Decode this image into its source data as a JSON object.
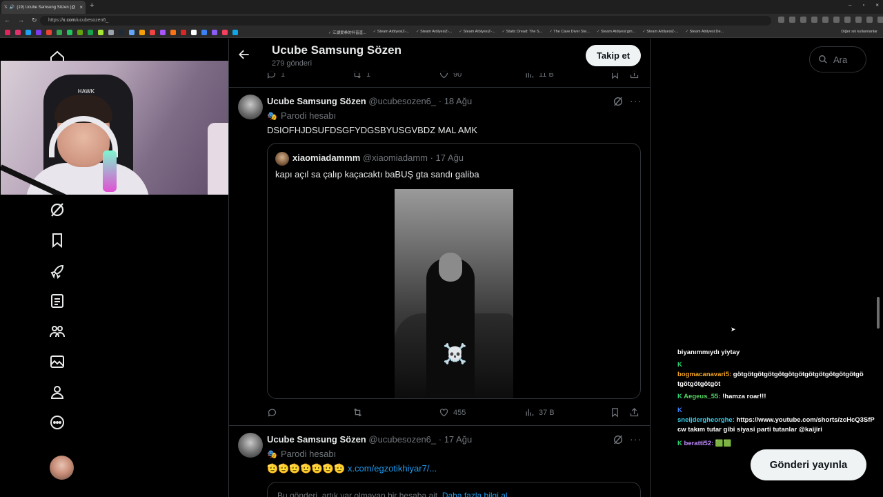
{
  "browser": {
    "tab_title": "(19) Ucube Samsung Sözen (@",
    "url_prefix": "https://",
    "url_host": "x.com",
    "url_path": "/ucubesozen6_",
    "bookmarks": [
      "江湖爱拳的抖音直...",
      "Steam AtölyesiZ-...",
      "Steam AtölyesiZ-...",
      "Steam AtölyesiZ-...",
      "Static Dread: The S...",
      "The Cave Diver Ste...",
      "Steam Atölyesi:gm...",
      "Steam AtölyesiZ-...",
      "Steam Atölyesi:De..."
    ],
    "bookmarks_other": "Diğer sık kullanılanlar",
    "bookmark_icon_colors": [
      "#e0245e",
      "#e1306c",
      "#1da1f2",
      "#7c3aed",
      "#ea4335",
      "#34a853",
      "#22c55e",
      "#65a30d",
      "#16a34a",
      "#a3e635",
      "#9ca3af",
      "#1f2937",
      "#60a5fa",
      "#f59e0b",
      "#ef4444",
      "#a855f7",
      "#f97316",
      "#dc2626",
      "#ffffff",
      "#3b82f6",
      "#8b5cf6",
      "#f43f5e",
      "#0ea5e9"
    ]
  },
  "header": {
    "profile_name": "Ucube Samsung Sözen",
    "post_count": "279 gönderi",
    "follow_label": "Takip et"
  },
  "top_post_actions": {
    "replies": "1",
    "reposts": "1",
    "likes": "90",
    "views": "11 B"
  },
  "post1": {
    "name": "Ucube Samsung Sözen",
    "handle": "@ucubesozen6_ · 18 Ağu",
    "parody": "Parodi hesabı",
    "text": "DSIOFHJDSUFDSGFYDGSBYUSGVBDZ MAL AMK",
    "quote": {
      "name": "xiaomiadammm",
      "handle": "@xiaomiadamm · 17 Ağu",
      "text": "kapı açıl sa çalıp kaçacaktı baBUŞ gta sandı galiba",
      "media_overlay": "☠️"
    },
    "actions": {
      "replies": "",
      "reposts": "",
      "likes": "455",
      "views": "37 B"
    }
  },
  "post2": {
    "name": "Ucube Samsung Sözen",
    "handle": "@ucubesozen6_ · 17 Ağu",
    "parody": "Parodi hesabı",
    "emojis": "🫡🫡🫡🫡🫡🫡🫡",
    "link": "x.com/egzotikhiyar7/...",
    "quote_text": "Bu gönderi, artık var olmayan bir hesaba ait.",
    "quote_link": "Daha fazla bilgi al"
  },
  "sidebar": {
    "search_placeholder": "Ara",
    "publish_label": "Gönderi yayınla"
  },
  "chat": [
    {
      "user": "",
      "text": "biyanımmıydı yiytay"
    },
    {
      "badge": "K",
      "user": "",
      "text": ""
    },
    {
      "user": "bogmacanavari5:",
      "text": "götgötgötgötgötgötgötgötgötgötgötgötgö"
    },
    {
      "user": "",
      "text": "tgötgötgötgöt"
    },
    {
      "badge": "K",
      "user": "Aegeus_55:",
      "text": "!hamza roar!!!"
    },
    {
      "badge": "K",
      "user": "",
      "text": ""
    },
    {
      "user": "sneijdergheorghe:",
      "text": "https://www.youtube.com/shorts/zcHcQ3SfP"
    },
    {
      "user": "",
      "text": "cw takım tutar gibi siyasi parti tutanlar @kaijiri"
    },
    {
      "badge": "K",
      "user": "beratti52:",
      "text": "🟩🟩"
    }
  ],
  "colors": {
    "background": "#000000",
    "text_primary": "#e7e9ea",
    "text_secondary": "#71767b",
    "link": "#1d9bf0",
    "border": "#2f3336",
    "button_light": "#eff3f4"
  }
}
